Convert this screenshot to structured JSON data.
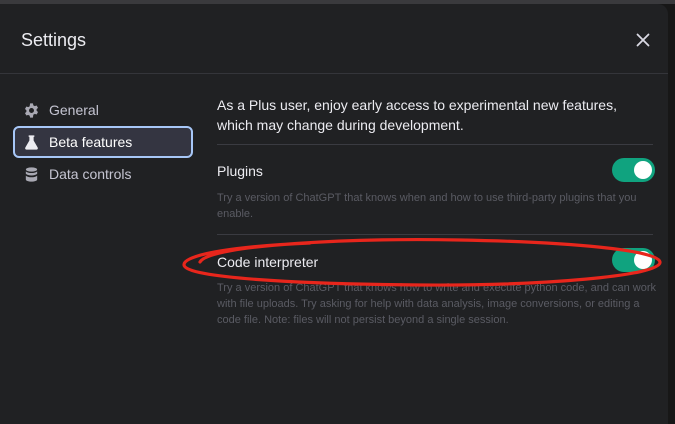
{
  "dialog": {
    "title": "Settings",
    "close_icon": "close-icon"
  },
  "sidebar": {
    "items": [
      {
        "label": "General",
        "icon": "gear-icon",
        "active": false
      },
      {
        "label": "Beta features",
        "icon": "flask-icon",
        "active": true
      },
      {
        "label": "Data controls",
        "icon": "database-icon",
        "active": false
      }
    ]
  },
  "main": {
    "intro": "As a Plus user, enjoy early access to experimental new features, which may change during development.",
    "features": [
      {
        "label": "Plugins",
        "description": "Try a version of ChatGPT that knows when and how to use third-party plugins that you enable.",
        "enabled": true
      },
      {
        "label": "Code interpreter",
        "description": "Try a version of ChatGPT that knows how to write and execute python code, and can work with file uploads. Try asking for help with data analysis, image conversions, or editing a code file. Note: files will not persist beyond a single session.",
        "enabled": true
      }
    ]
  },
  "colors": {
    "toggle_on": "#10a37f",
    "annotation": "#e8261c",
    "dialog_bg": "#202123"
  }
}
